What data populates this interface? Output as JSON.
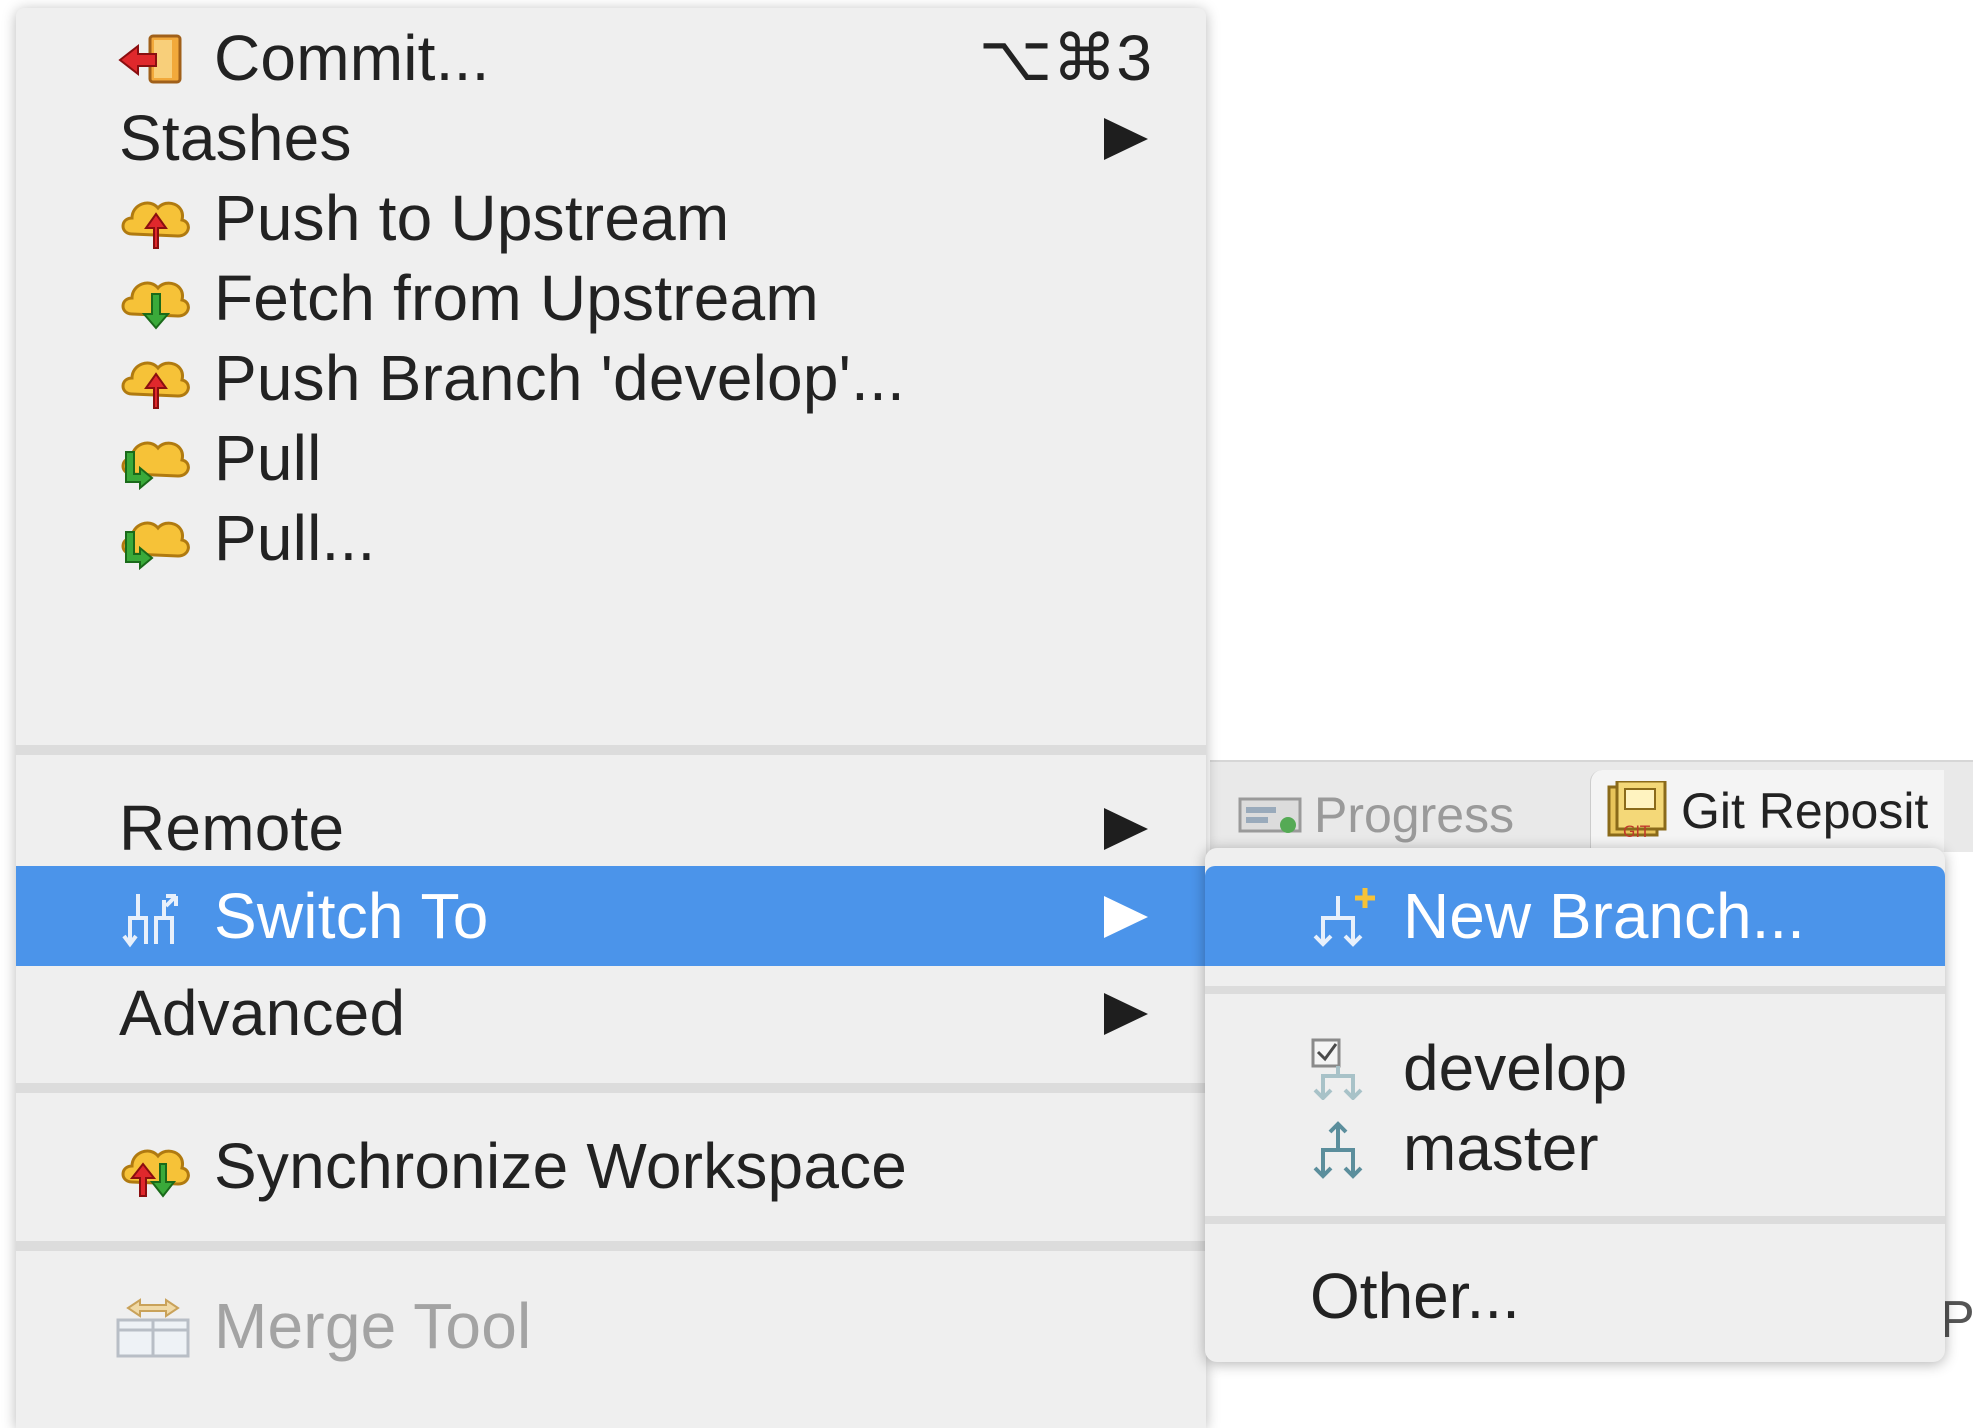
{
  "background": {
    "view_tabs": [
      {
        "label": "Progress",
        "icon": "progress-icon"
      },
      {
        "label": "Git Reposit",
        "icon": "git-repositories-icon"
      }
    ],
    "stray_text": "P"
  },
  "menu": {
    "items": [
      {
        "label": "Commit...",
        "shortcut": "⌥⌘3",
        "icon": "commit-icon"
      },
      {
        "label": "Stashes",
        "submenu": true
      },
      {
        "label": "Push to Upstream",
        "icon": "cloud-push-icon"
      },
      {
        "label": "Fetch from Upstream",
        "icon": "cloud-fetch-icon"
      },
      {
        "label": "Push Branch 'develop'...",
        "icon": "cloud-push-icon"
      },
      {
        "label": "Pull",
        "icon": "cloud-pull-icon"
      },
      {
        "label": "Pull...",
        "icon": "cloud-pull-icon"
      },
      {
        "label": "Remote",
        "submenu": true
      },
      {
        "label": "Switch To",
        "submenu": true,
        "selected": true,
        "icon": "branch-switch-icon"
      },
      {
        "label": "Advanced",
        "submenu": true
      },
      {
        "label": "Synchronize Workspace",
        "icon": "cloud-sync-icon"
      },
      {
        "label": "Merge Tool",
        "icon": "merge-tool-icon",
        "disabled": true
      }
    ]
  },
  "submenu": {
    "items": [
      {
        "label": "New Branch...",
        "icon": "new-branch-icon",
        "selected": true
      },
      {
        "label": "develop",
        "icon": "checked-branch-icon"
      },
      {
        "label": "master",
        "icon": "branch-icon"
      },
      {
        "label": "Other..."
      }
    ]
  },
  "colors": {
    "selection": "#4b94ea",
    "menu_bg": "#efefef",
    "separator": "#dcdcdc",
    "disabled_text": "#a3a3a3"
  }
}
